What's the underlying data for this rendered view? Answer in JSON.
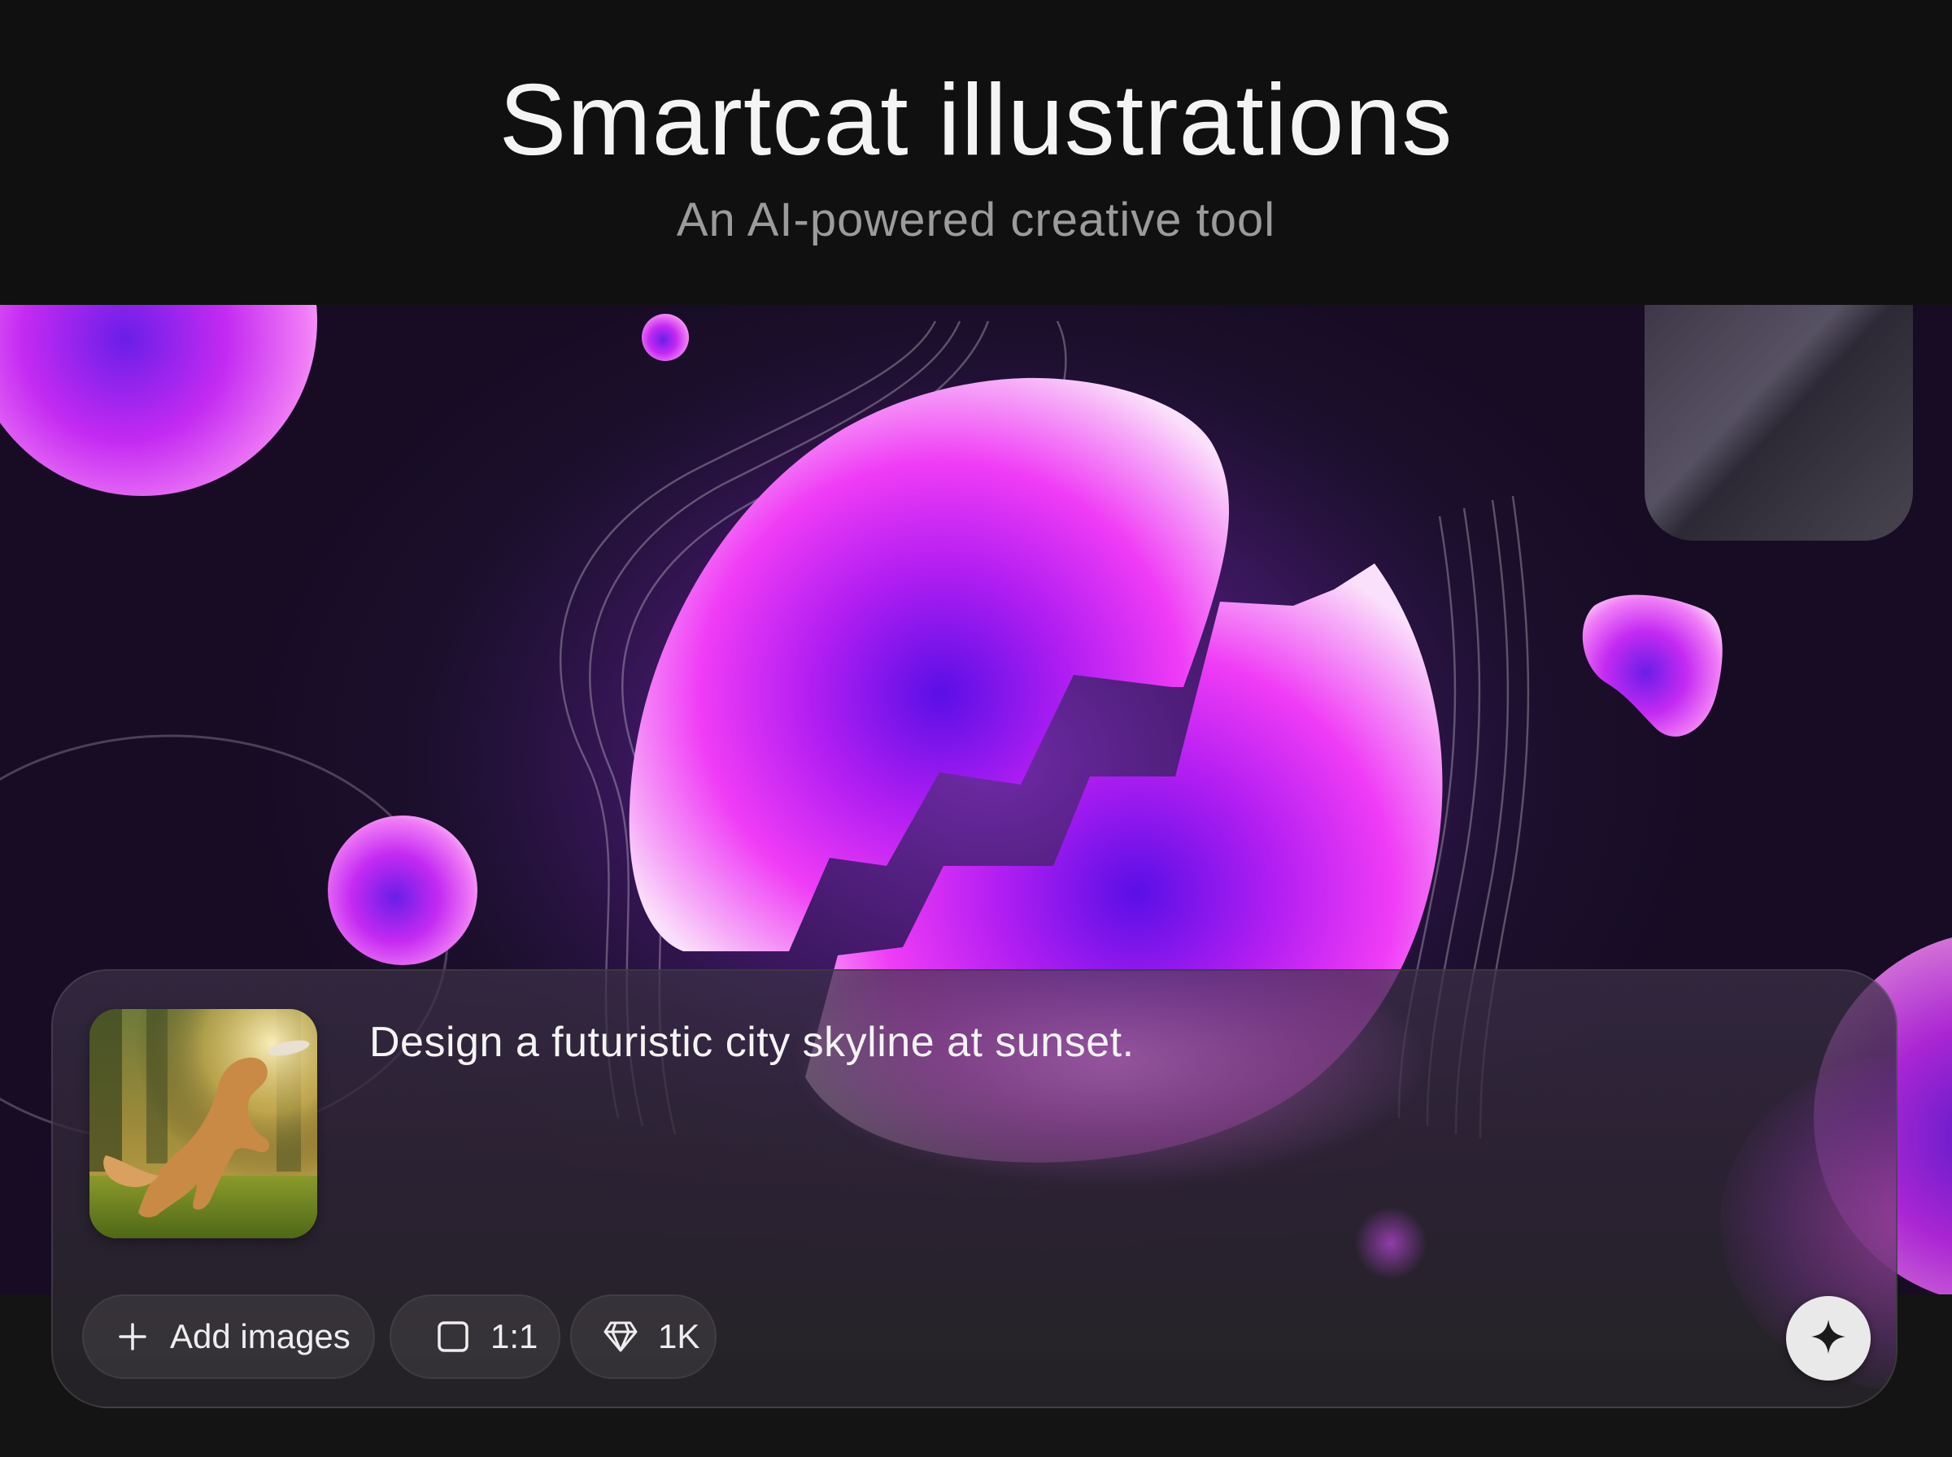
{
  "header": {
    "title": "Smartcat illustrations",
    "subtitle": "An AI-powered creative tool"
  },
  "composer": {
    "prompt_text": "Design a futuristic city skyline at sunset.",
    "attachment_icon": "dog-photo-thumbnail",
    "chips": {
      "add_images_label": "Add images",
      "aspect_ratio_label": "1:1",
      "resolution_label": "1K"
    },
    "icons": {
      "add": "plus-icon",
      "aspect": "square-icon",
      "resolution": "diamond-icon",
      "send": "sparkle-icon"
    }
  },
  "colors": {
    "background": "#101010",
    "accent_magenta": "#e83cf0",
    "accent_violet": "#6a1ee0",
    "text_primary": "#f4f4f4",
    "text_secondary": "#9b9b9b"
  }
}
